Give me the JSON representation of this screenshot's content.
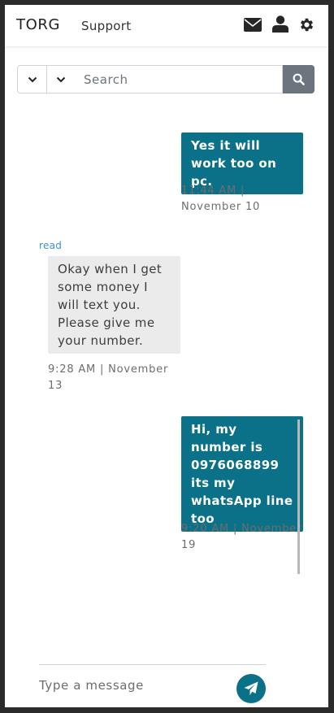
{
  "header": {
    "brand": "TORG",
    "support_label": "Support",
    "icons": [
      "envelope-icon",
      "user-icon",
      "gear-icon"
    ]
  },
  "search": {
    "placeholder": "Search",
    "value": ""
  },
  "messages": [
    {
      "direction": "outgoing",
      "text": "Yes it will work too on pc.",
      "time": "11:44 AM |",
      "date": "November 10"
    },
    {
      "direction": "incoming",
      "status": "read",
      "text": "Okay when I get some money I will text you. Please give me your number.",
      "time": "9:28 AM | November",
      "date": "13"
    },
    {
      "direction": "outgoing",
      "text": "Hi, my number is 0976068899 its my whatsApp line too",
      "time": "9:20 AM | November",
      "date": "19"
    }
  ],
  "composer": {
    "placeholder": "Type a message",
    "value": ""
  },
  "colors": {
    "outgoing_bubble": "#0b7189",
    "incoming_bubble": "#ebebeb",
    "read_label": "#3f8fd8",
    "search_button": "#6c757d",
    "send_button": "#0b7189"
  }
}
